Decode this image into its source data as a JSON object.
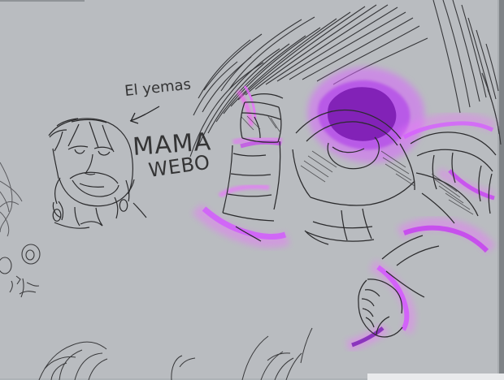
{
  "colors": {
    "background": "#b9bcc0",
    "sketch_line": "#2f2f31",
    "purple_glow": "#d36bff",
    "purple_core": "#7a1ab0",
    "purple_mid": "#b247e9"
  },
  "annotations": {
    "note_top": "El yemas",
    "note_main_line1": "MAMA",
    "note_main_line2": "WEBO"
  }
}
